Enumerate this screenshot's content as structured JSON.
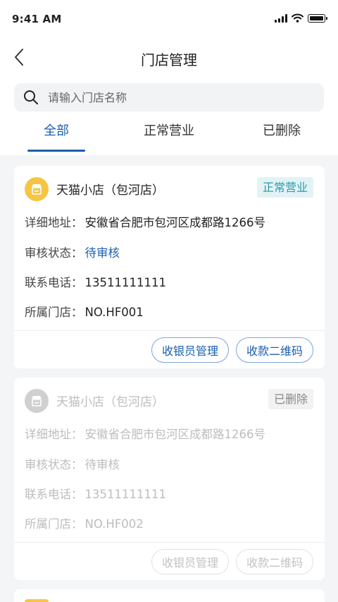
{
  "status_bar": {
    "time": "9:41 AM"
  },
  "nav": {
    "title": "门店管理"
  },
  "search": {
    "placeholder": "请输入门店名称"
  },
  "tabs": [
    {
      "label": "全部",
      "active": true
    },
    {
      "label": "正常营业",
      "active": false
    },
    {
      "label": "已删除",
      "active": false
    }
  ],
  "labels": {
    "address": "详细地址：",
    "review": "审核状态：",
    "phone": "联系电话：",
    "store": "所属门店："
  },
  "stores": [
    {
      "name": "天猫小店（包河店）",
      "badge": "正常营业",
      "address": "安徽省合肥市包河区成都路1266号",
      "review_status": "待审核",
      "phone": "13511111111",
      "store_no": "NO.HF001",
      "cashier_button": "收银员管理",
      "qr_button": "收款二维码",
      "state": "active"
    },
    {
      "name": "天猫小店（包河店）",
      "badge": "已删除",
      "address": "安徽省合肥市包河区成都路1266号",
      "review_status": "待审核",
      "phone": "13511111111",
      "store_no": "NO.HF002",
      "cashier_button": "收银员管理",
      "qr_button": "收款二维码",
      "state": "deleted"
    }
  ],
  "colors": {
    "accent": "#1a5fb0",
    "active_badge_bg": "#e3f3f5",
    "active_badge_text": "#2a9aa8",
    "deleted_badge_bg": "#f2f2f2",
    "deleted_badge_text": "#888888",
    "store_icon_active": "#f6c544",
    "store_icon_deleted": "#d0d0d0"
  }
}
